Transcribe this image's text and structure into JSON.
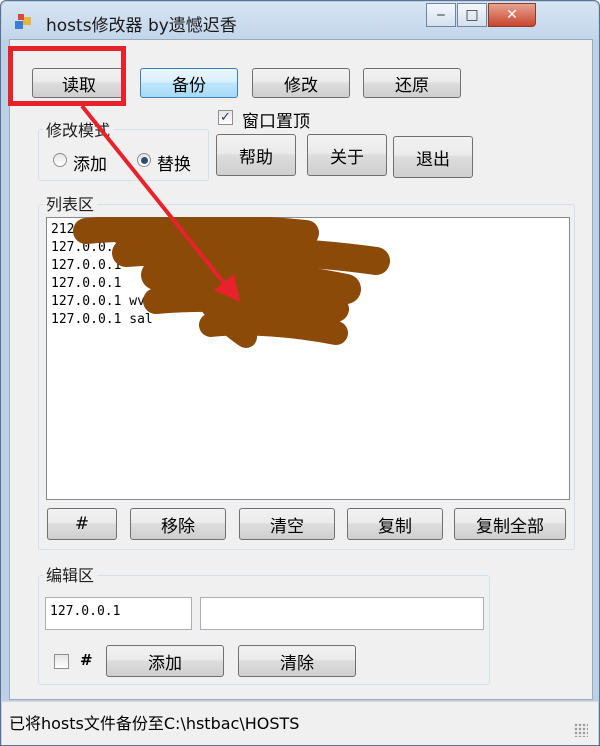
{
  "window": {
    "title": "hosts修改器 by遗憾迟香",
    "minimize_glyph": "‒",
    "maximize_glyph": "□",
    "close_glyph": "✕"
  },
  "toolbar": {
    "read_label": "读取",
    "backup_label": "备份",
    "modify_label": "修改",
    "restore_label": "还原"
  },
  "options": {
    "always_on_top_label": "窗口置顶",
    "always_on_top_checked": "✓",
    "help_label": "帮助",
    "about_label": "关于",
    "exit_label": "退出"
  },
  "modify_mode": {
    "group_label": "修改模式",
    "add_label": "添加",
    "replace_label": "替换",
    "selected": "replace"
  },
  "list_area": {
    "group_label": "列表区",
    "items": [
      "212.",
      "127.0.0.1",
      "127.0.0.1",
      "127.0.0.1",
      "127.0.0.1 wv",
      "127.0.0.1 sal"
    ],
    "buttons": {
      "hash_label": "#",
      "remove_label": "移除",
      "clear_label": "清空",
      "copy_label": "复制",
      "copy_all_label": "复制全部"
    }
  },
  "edit_area": {
    "group_label": "编辑区",
    "ip_value": "127.0.0.1",
    "host_value": "",
    "hash_checkbox_label": "#",
    "add_label": "添加",
    "clear_label": "清除"
  },
  "status": {
    "text": "已将hosts文件备份至C:\\hstbac\\HOSTS"
  },
  "annotation": {
    "color": "#e8222b",
    "redaction_color": "#8b4a08"
  }
}
